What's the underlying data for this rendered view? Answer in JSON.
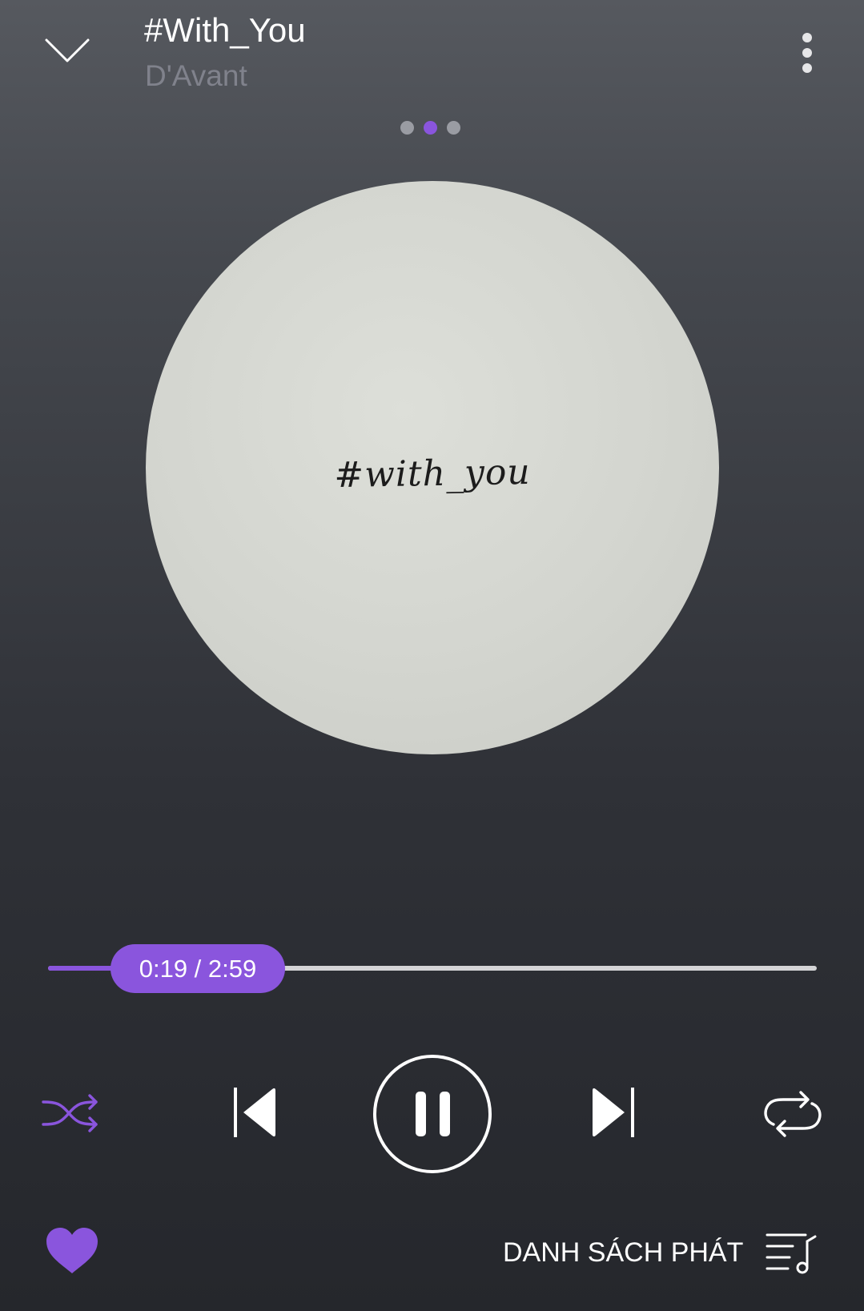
{
  "colors": {
    "accent": "#8a55dd",
    "muted": "#80828c",
    "light": "#ffffff"
  },
  "header": {
    "title": "#With_You",
    "artist": "D'Avant",
    "collapse_icon": "chevron-down-icon",
    "more_icon": "more-vertical-icon"
  },
  "pager": {
    "count": 3,
    "active_index": 1
  },
  "album_art": {
    "handwritten_text": "#with_you"
  },
  "progress": {
    "current": "0:19",
    "total": "2:59",
    "label": "0:19 / 2:59",
    "fraction": 0.106
  },
  "controls": {
    "shuffle_icon": "shuffle-icon",
    "previous_icon": "skip-previous-icon",
    "play_state_icon": "pause-icon",
    "next_icon": "skip-next-icon",
    "repeat_icon": "repeat-icon"
  },
  "footer": {
    "favorite_icon": "heart-icon",
    "playlist_label": "DANH SÁCH PHÁT",
    "playlist_icon": "playlist-music-icon"
  }
}
